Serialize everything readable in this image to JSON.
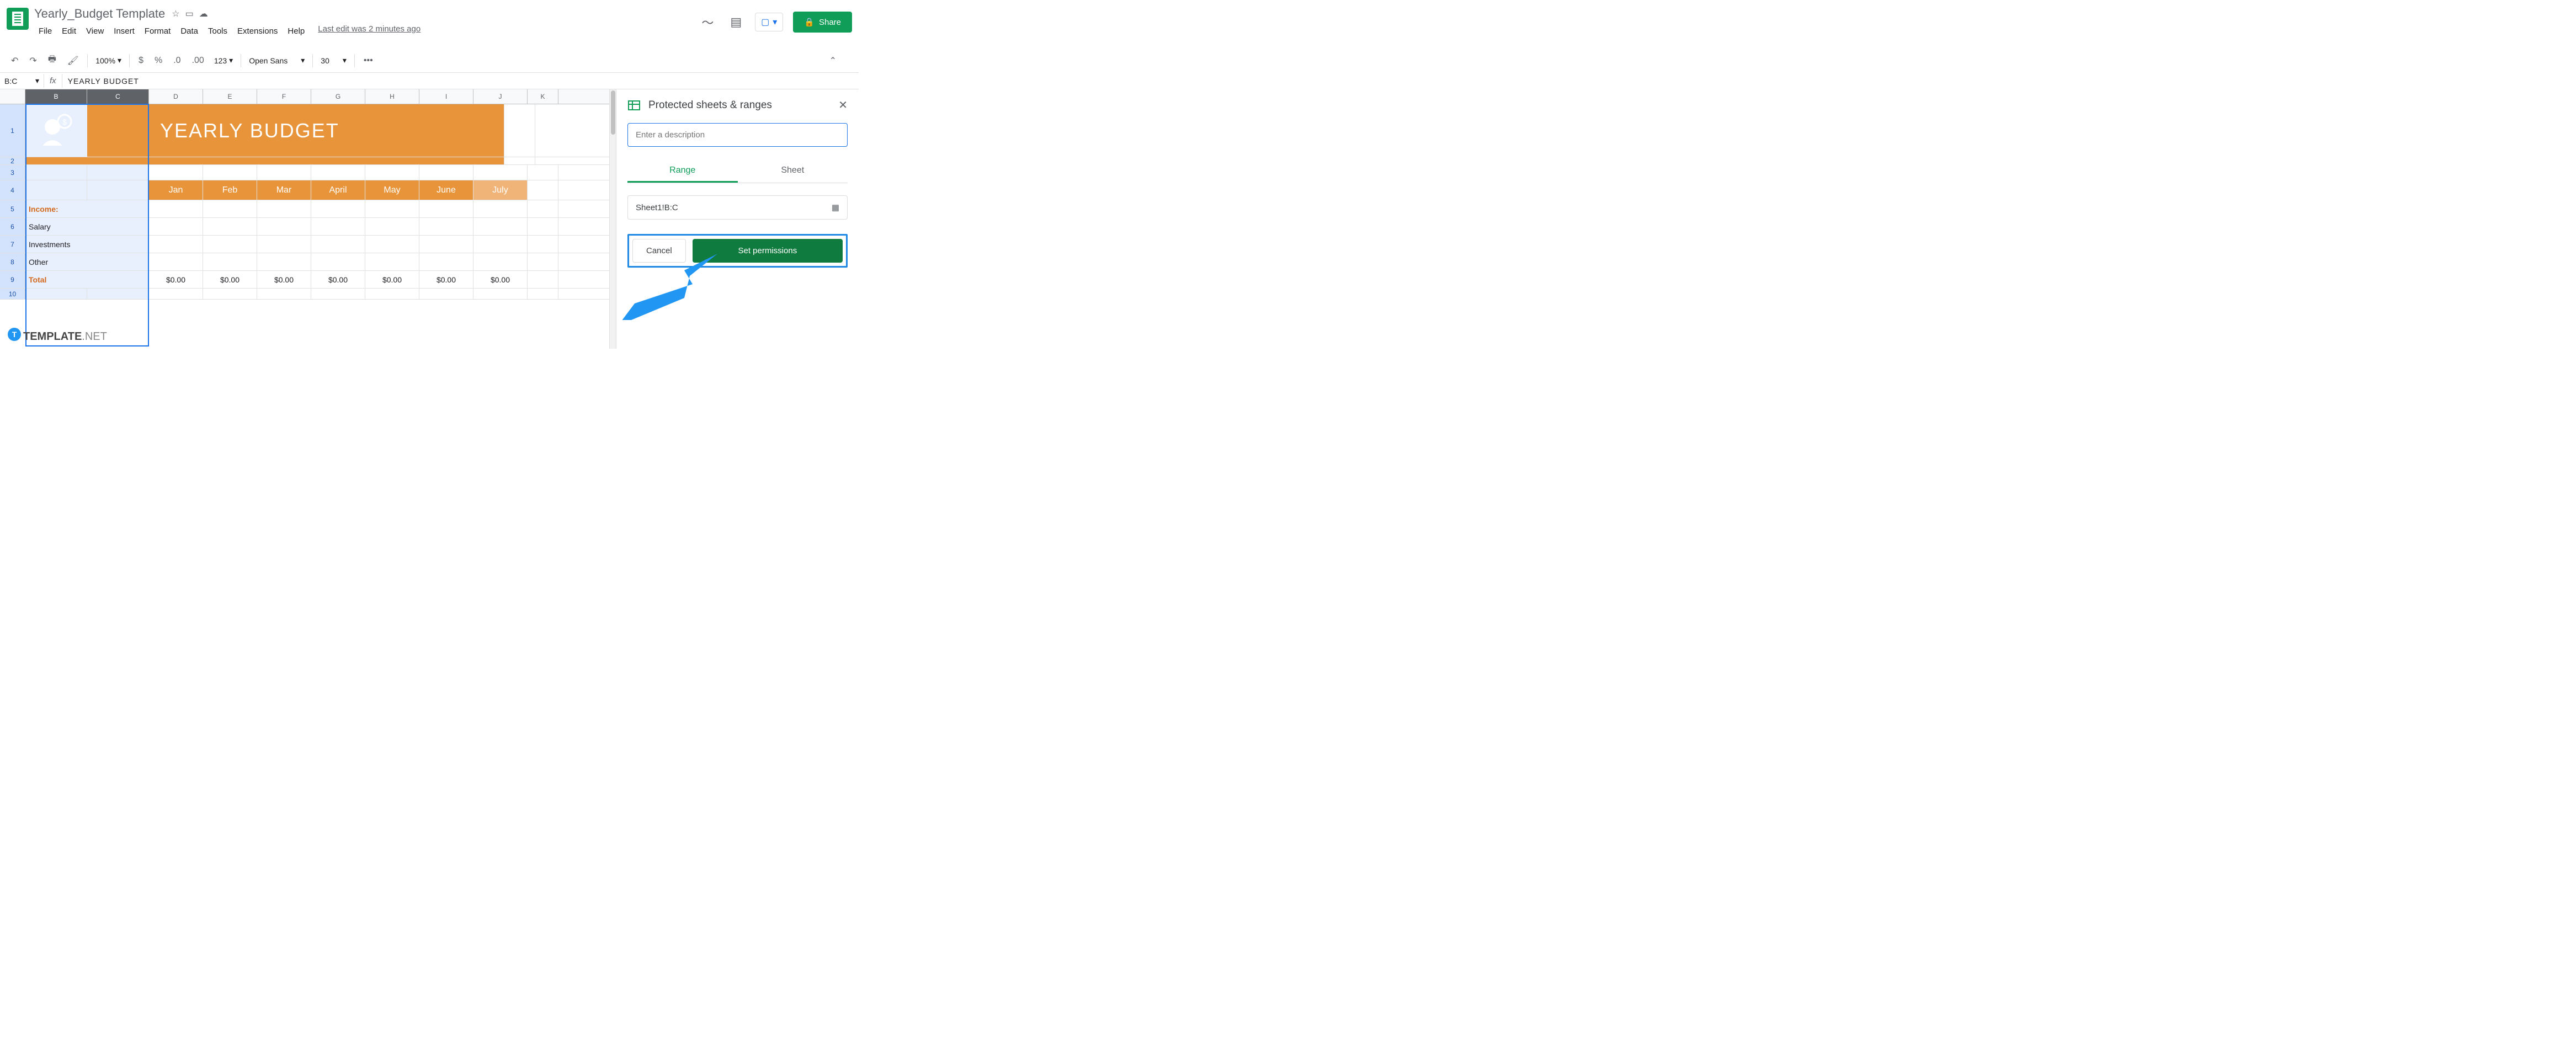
{
  "doc_title": "Yearly_Budget Template",
  "menus": [
    "File",
    "Edit",
    "View",
    "Insert",
    "Format",
    "Data",
    "Tools",
    "Extensions",
    "Help"
  ],
  "last_edit": "Last edit was 2 minutes ago",
  "share_label": "Share",
  "toolbar": {
    "zoom": "100%",
    "font": "Open Sans",
    "size": "30",
    "currency": "$",
    "percent": "%",
    "dec_dec": ".0",
    "dec_inc": ".00",
    "fmt": "123"
  },
  "name_box": "B:C",
  "formula": "YEARLY  BUDGET",
  "columns": [
    "B",
    "C",
    "D",
    "E",
    "F",
    "G",
    "H",
    "I",
    "J",
    "K"
  ],
  "banner_text": "YEARLY  BUDGET",
  "months": [
    "Jan",
    "Feb",
    "Mar",
    "April",
    "May",
    "June",
    "July"
  ],
  "rows": {
    "income": "Income:",
    "salary": "Salary",
    "investments": "Investments",
    "other": "Other",
    "total": "Total"
  },
  "totals": [
    "$0.00",
    "$0.00",
    "$0.00",
    "$0.00",
    "$0.00",
    "$0.00",
    "$0.00"
  ],
  "panel": {
    "title": "Protected sheets & ranges",
    "desc_placeholder": "Enter a description",
    "tab_range": "Range",
    "tab_sheet": "Sheet",
    "range_value": "Sheet1!B:C",
    "cancel": "Cancel",
    "set_perms": "Set permissions"
  },
  "watermark": {
    "a": "TEMPLATE",
    "b": ".NET"
  }
}
